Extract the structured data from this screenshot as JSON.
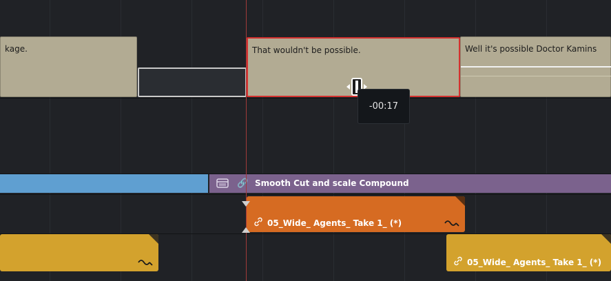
{
  "timeline": {
    "subtitles": [
      {
        "text": "kage.",
        "state": "normal"
      },
      {
        "text": "",
        "state": "gap"
      },
      {
        "text": "That wouldn't be possible.",
        "state": "selected"
      },
      {
        "text": "Well it's possible Doctor Kamins",
        "state": "normal"
      }
    ],
    "trim_tooltip": "-00:17",
    "compound_clip": {
      "label": "Smooth Cut and scale Compound",
      "icon": "compound-clip-icon",
      "link_icon": "link-icon"
    },
    "video_clip_v1": {
      "label": "05_Wide_ Agents_ Take 1_ (*)",
      "icon": "link-icon"
    },
    "audio_clips": [
      {
        "label": ""
      },
      {
        "label": "05_Wide_ Agents_ Take 1_ (*)",
        "icon": "link-icon"
      }
    ],
    "colors": {
      "playhead": "#a33a3a",
      "selected_border": "#d5312f",
      "subtitle_clip": "#b2ab93",
      "compound_clip": "#7b628d",
      "blue_clip": "#5f9fd1",
      "orange_clip": "#d66b22",
      "yellow_clip": "#d3a22d"
    }
  }
}
